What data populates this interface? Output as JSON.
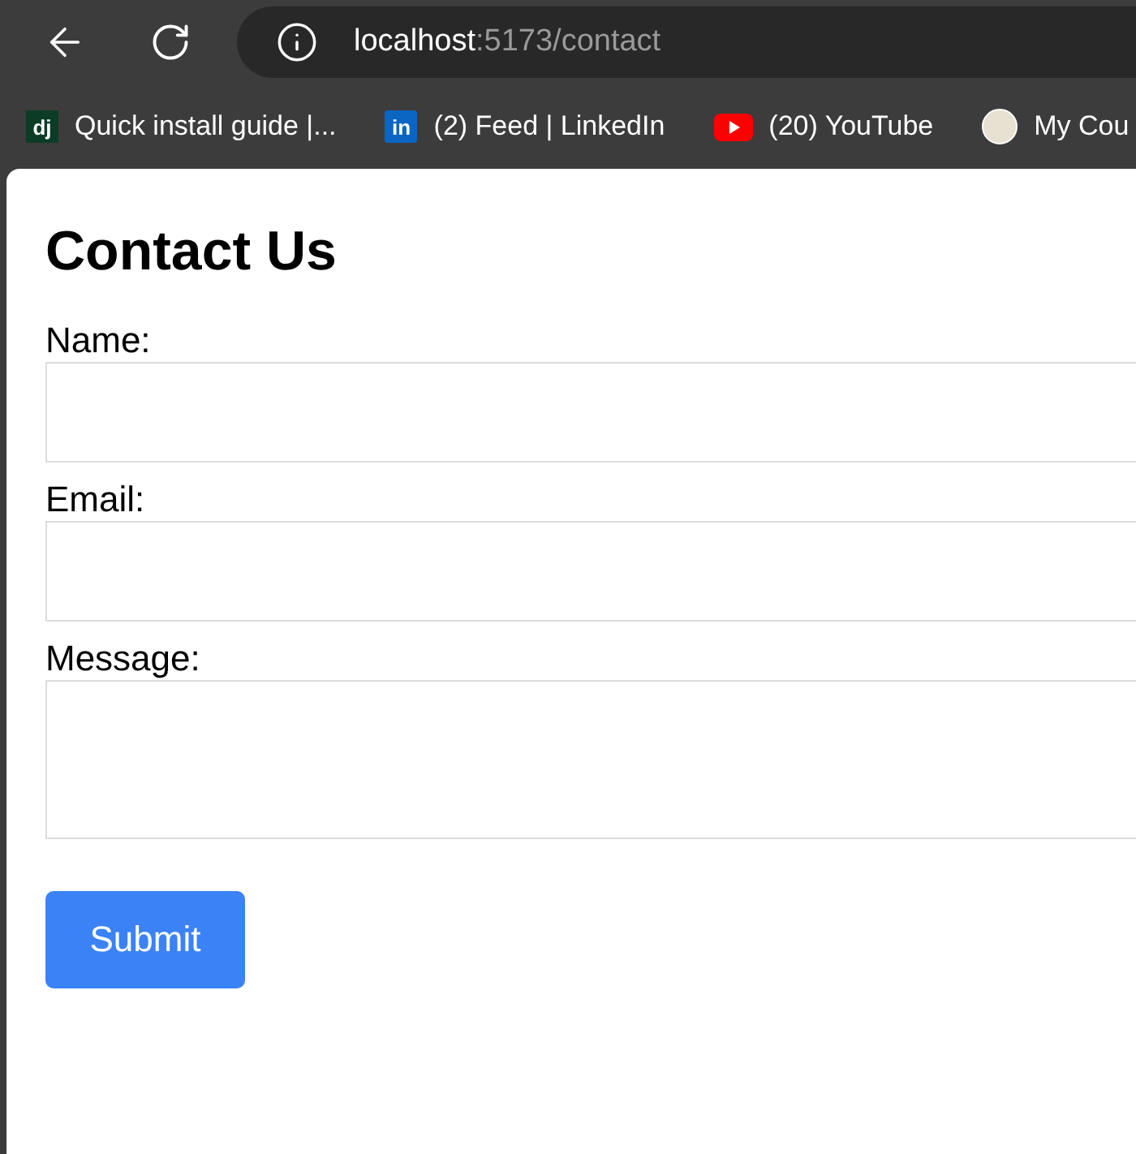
{
  "browser": {
    "address": {
      "host": "localhost",
      "rest": ":5173/contact"
    },
    "bookmarks": [
      {
        "kind": "letters-dark",
        "icon_text": "dj",
        "label": "Quick install guide |..."
      },
      {
        "kind": "letters-blue",
        "icon_text": "in",
        "label": "(2) Feed | LinkedIn"
      },
      {
        "kind": "play",
        "label": "(20) YouTube"
      },
      {
        "kind": "avatar",
        "label": "My Cou"
      }
    ]
  },
  "page": {
    "title": "Contact Us",
    "fields": [
      {
        "kind": "input",
        "label": "Name:"
      },
      {
        "kind": "input",
        "label": "Email:"
      },
      {
        "kind": "textarea",
        "label": "Message:"
      }
    ],
    "submit": "Submit"
  }
}
